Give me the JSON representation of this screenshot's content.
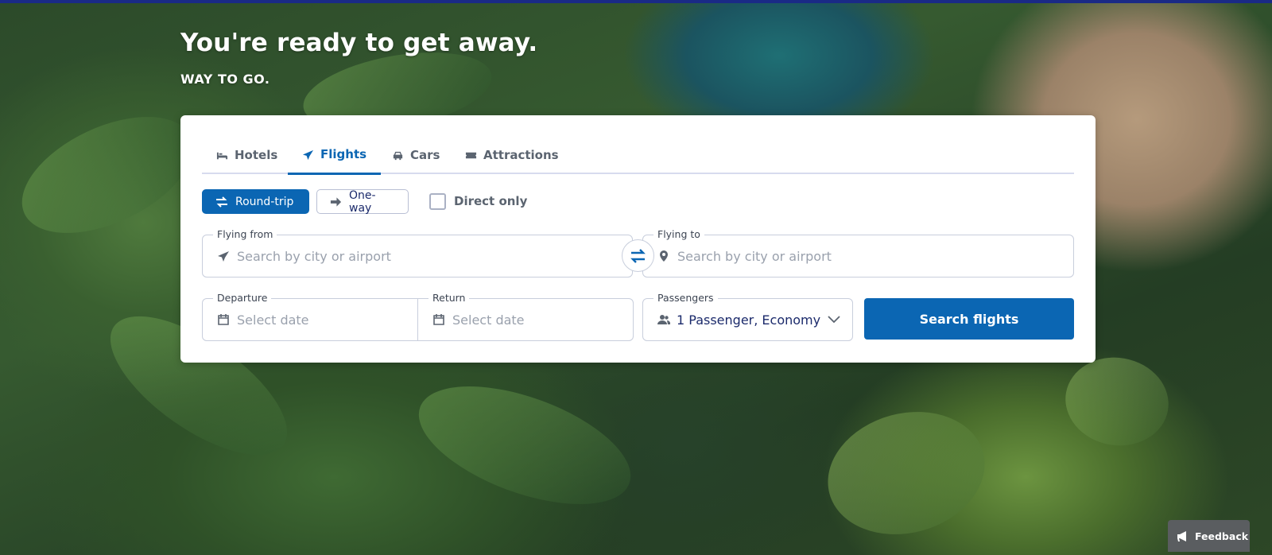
{
  "hero": {
    "headline": "You're ready to get away.",
    "subhead": "WAY TO GO."
  },
  "tabs": [
    {
      "label": "Hotels",
      "icon": "bed-icon",
      "active": false
    },
    {
      "label": "Flights",
      "icon": "plane-icon",
      "active": true
    },
    {
      "label": "Cars",
      "icon": "car-icon",
      "active": false
    },
    {
      "label": "Attractions",
      "icon": "ticket-icon",
      "active": false
    }
  ],
  "trip_type": {
    "round_trip": "Round-trip",
    "one_way": "One-way",
    "selected": "Round-trip"
  },
  "direct_only": {
    "label": "Direct only",
    "checked": false
  },
  "flying_from": {
    "label": "Flying from",
    "placeholder": "Search by city or airport",
    "value": ""
  },
  "flying_to": {
    "label": "Flying to",
    "placeholder": "Search by city or airport",
    "value": ""
  },
  "departure": {
    "label": "Departure",
    "placeholder": "Select date"
  },
  "return": {
    "label": "Return",
    "placeholder": "Select date"
  },
  "passengers": {
    "label": "Passengers",
    "value": "1 Passenger, Economy"
  },
  "search_button": "Search flights",
  "feedback": "Feedback",
  "colors": {
    "brand_blue": "#0b66b3",
    "navy": "#1b2a6b",
    "top_bar": "#1a2a86"
  }
}
